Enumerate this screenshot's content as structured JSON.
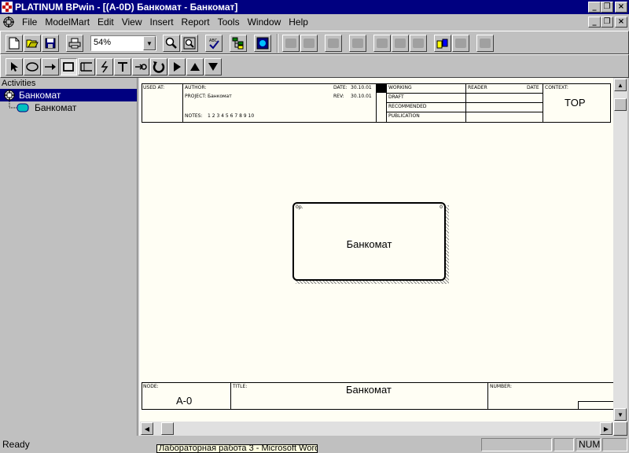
{
  "window": {
    "title": "PLATINUM BPwin - [(A-0D) Банкомат - Банкомат]",
    "controls": {
      "minimize": "_",
      "restore": "❐",
      "close": "×"
    }
  },
  "menu": {
    "items": [
      "File",
      "ModelMart",
      "Edit",
      "View",
      "Insert",
      "Report",
      "Tools",
      "Window",
      "Help"
    ]
  },
  "toolbar": {
    "zoom_value": "54%",
    "buttons": [
      "new-icon",
      "open-icon",
      "save-icon",
      "print-icon",
      "zoom-in-icon",
      "zoom-fit-icon",
      "spell-check-icon",
      "model-explorer-icon",
      "modelmart-icon"
    ]
  },
  "drawtools": {
    "buttons": [
      "pointer-icon",
      "activity-oval-icon",
      "arrow-icon",
      "activity-box-icon",
      "datastore-icon",
      "squiggle-icon",
      "text-icon",
      "tunnel-arrow-icon",
      "go-to-parent-icon",
      "play-icon",
      "up-icon",
      "down-icon"
    ]
  },
  "tree": {
    "header": "Activities",
    "root": "Банкомат",
    "child": "Банкомат"
  },
  "frame": {
    "used_at": "USED AT:",
    "author_label": "AUTHOR:",
    "project_label": "PROJECT:",
    "project_value": "Банкомат",
    "notes_label": "NOTES:",
    "notes_value": "1 2 3 4 5 6 7 8 9 10",
    "date_label": "DATE:",
    "date_value": "30.10.01",
    "rev_label": "REV:",
    "rev_value": "30.10.01",
    "status": [
      "WORKING",
      "DRAFT",
      "RECOMMENDED",
      "PUBLICATION"
    ],
    "reader_label": "READER",
    "date2_label": "DATE",
    "context_label": "CONTEXT:",
    "context_value": "TOP",
    "node_label": "NODE:",
    "node_value": "A-0",
    "title_label": "TITLE:",
    "title_value": "Банкомат",
    "number_label": "NUMBER:"
  },
  "activity": {
    "label": "Банкомат",
    "corner_label": "0p.",
    "corner_right": "0"
  },
  "status_bar": {
    "text": "Ready",
    "num": "NUM"
  },
  "tooltip": "Лабораторная работа 3 - Microsoft Word",
  "colors": {
    "titlebar": "#000080",
    "canvas": "#fffef4",
    "chrome": "#c0c0c0",
    "activity_fill": "#fffef4"
  }
}
